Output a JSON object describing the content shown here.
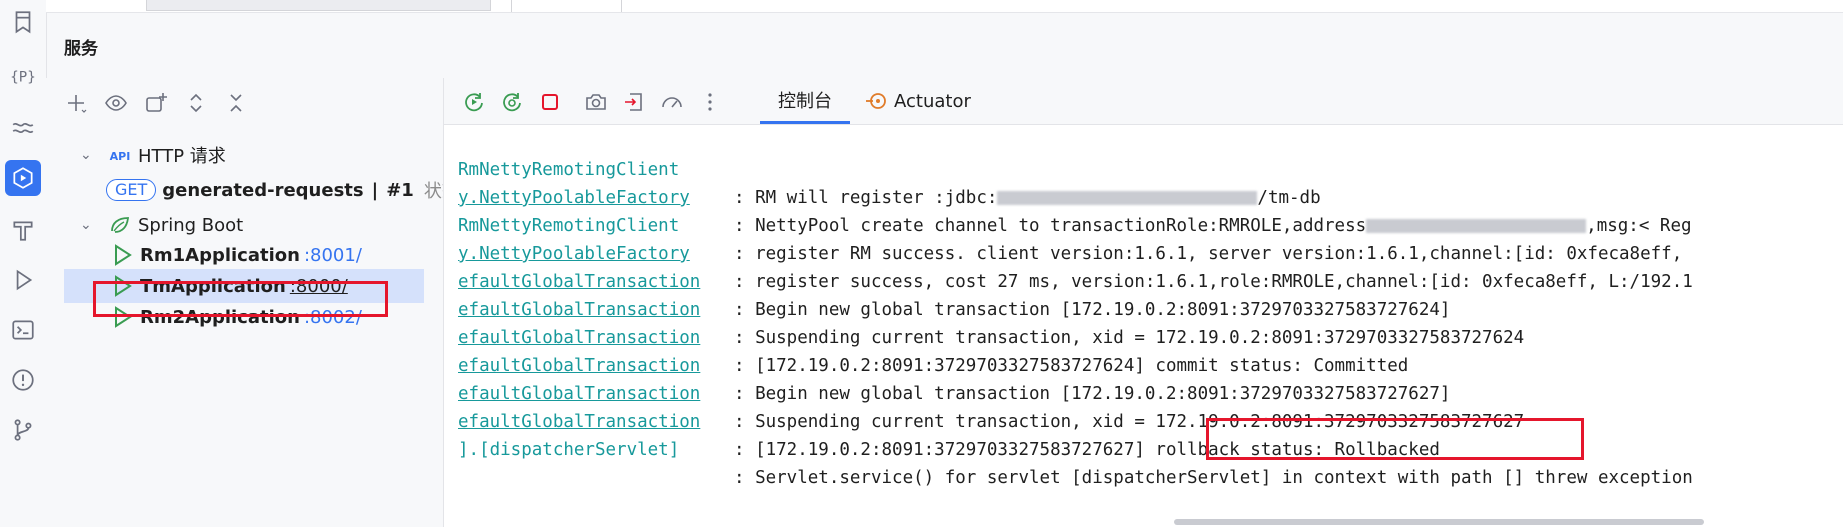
{
  "panel_title": "服务",
  "left_strip_icons": [
    "bookmark-icon",
    "structure-icon",
    "endpoints-icon",
    "services-icon",
    "build-icon",
    "run-icon",
    "terminal-icon",
    "problems-icon",
    "git-icon"
  ],
  "tree": {
    "toolbar_icons": [
      "add-icon",
      "eye-icon",
      "new-group-icon",
      "expand-all-icon",
      "collapse-all-icon"
    ],
    "http_group_label": "HTTP 请求",
    "http_request": {
      "method": "GET",
      "name": "generated-requests",
      "separator": "|",
      "run_id": "#1",
      "status_text": "状态"
    },
    "spring_group_label": "Spring Boot",
    "apps": [
      {
        "name": "Rm1Application",
        "port": ":8001/"
      },
      {
        "name": "TmApplication",
        "port": ":8000/"
      },
      {
        "name": "Rm2Application",
        "port": ":8002/"
      }
    ]
  },
  "console": {
    "toolbar_icons": [
      "rerun-icon",
      "debug-rerun-icon",
      "stop-icon",
      "camera-icon",
      "export-icon",
      "dashboard-icon",
      "more-icon"
    ],
    "tabs": [
      {
        "label": "控制台"
      },
      {
        "label": "Actuator"
      }
    ],
    "lines": [
      {
        "src": "RmNettyRemotingClient",
        "link": false,
        "msg_pre": ": RM will register :jdbc:",
        "msg_post": "/tm-db"
      },
      {
        "src": "y.NettyPoolableFactory",
        "link": true,
        "msg_pre": ": NettyPool create channel to transactionRole:RMROLE,address",
        "msg_post": ",msg:< Reg"
      },
      {
        "src": "RmNettyRemotingClient",
        "link": false,
        "msg": ": register RM success. client version:1.6.1, server version:1.6.1,channel:[id: 0xfeca8eff, "
      },
      {
        "src": "y.NettyPoolableFactory",
        "link": true,
        "msg": ": register success, cost 27 ms, version:1.6.1,role:RMROLE,channel:[id: 0xfeca8eff, L:/192.1"
      },
      {
        "src": "efaultGlobalTransaction",
        "link": true,
        "msg": ": Begin new global transaction [172.19.0.2:8091:3729703327583727624]"
      },
      {
        "src": "efaultGlobalTransaction",
        "link": true,
        "msg": ": Suspending current transaction, xid = 172.19.0.2:8091:3729703327583727624"
      },
      {
        "src": "efaultGlobalTransaction",
        "link": true,
        "msg": ": [172.19.0.2:8091:3729703327583727624] commit status: Committed"
      },
      {
        "src": "efaultGlobalTransaction",
        "link": true,
        "msg": ": Begin new global transaction [172.19.0.2:8091:3729703327583727627]"
      },
      {
        "src": "efaultGlobalTransaction",
        "link": true,
        "msg": ": Suspending current transaction, xid = 172.19.0.2:8091:3729703327583727627"
      },
      {
        "src": "efaultGlobalTransaction",
        "link": true,
        "msg": ": [172.19.0.2:8091:3729703327583727627] rollback status: Rollbacked"
      },
      {
        "src": "].[dispatcherServlet]",
        "link": false,
        "msg": ": Servlet.service() for servlet [dispatcherServlet] in context with path [] threw exception"
      }
    ]
  },
  "colors": {
    "accent": "#3574f0",
    "highlight_box": "#e5162c",
    "log_source": "#17999b",
    "run_icon": "#3a9c52"
  }
}
